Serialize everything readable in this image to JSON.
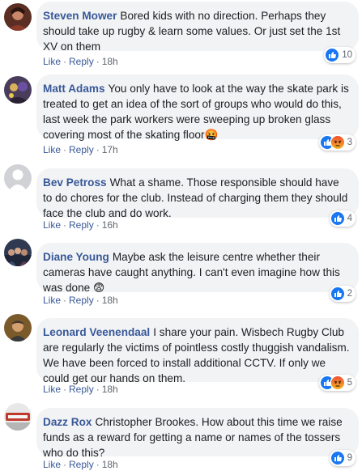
{
  "actions": {
    "like": "Like",
    "reply": "Reply",
    "sep": "·"
  },
  "colors": {
    "link": "#385898",
    "bubble": "#f2f3f5",
    "like_blue": "#1877f2",
    "angry": "#e9710f"
  },
  "comments": [
    {
      "author": "Steven Mower",
      "text": "Bored kids with no direction. Perhaps they should take up rugby & learn some values. Or just set the 1st XV on them",
      "time": "18h",
      "reactions": [
        "like-icon"
      ],
      "count": "10"
    },
    {
      "author": "Matt Adams",
      "text": "You only have to look at the way the skate park is treated to get an idea of the sort of groups who would do this, last week the park workers were sweeping up broken glass covering most of the skating floor",
      "emoji": "🤬",
      "time": "17h",
      "reactions": [
        "like-icon",
        "angry-icon"
      ],
      "count": "3"
    },
    {
      "author": "Bev Petross",
      "text": "What a shame. Those responsible should have to do chores for the club. Instead of charging them they should face the club and do work.",
      "time": "16h",
      "reactions": [
        "like-icon"
      ],
      "count": "4"
    },
    {
      "author": "Diane Young",
      "text": "Maybe ask the leisure centre whether their cameras have caught anything. I can't even imagine how this was done",
      "emoji": "😨",
      "time": "18h",
      "reactions": [
        "like-icon"
      ],
      "count": "2"
    },
    {
      "author": "Leonard Veenendaal",
      "text": "I share your pain. Wisbech Rugby Club are regularly the victims of pointless costly thuggish vandalism. We have been forced to install additional CCTV. If only we could get our hands on them.",
      "time": "18h",
      "reactions": [
        "like-icon",
        "angry-icon"
      ],
      "count": "5"
    },
    {
      "author": "Dazz Rox",
      "text": "Christopher Brookes. How about this time we raise funds as a reward for getting a name or names of the tossers who do this?",
      "tag_author": "Christopher Brookes",
      "time": "18h",
      "reactions": [
        "like-icon"
      ],
      "count": "9"
    }
  ]
}
